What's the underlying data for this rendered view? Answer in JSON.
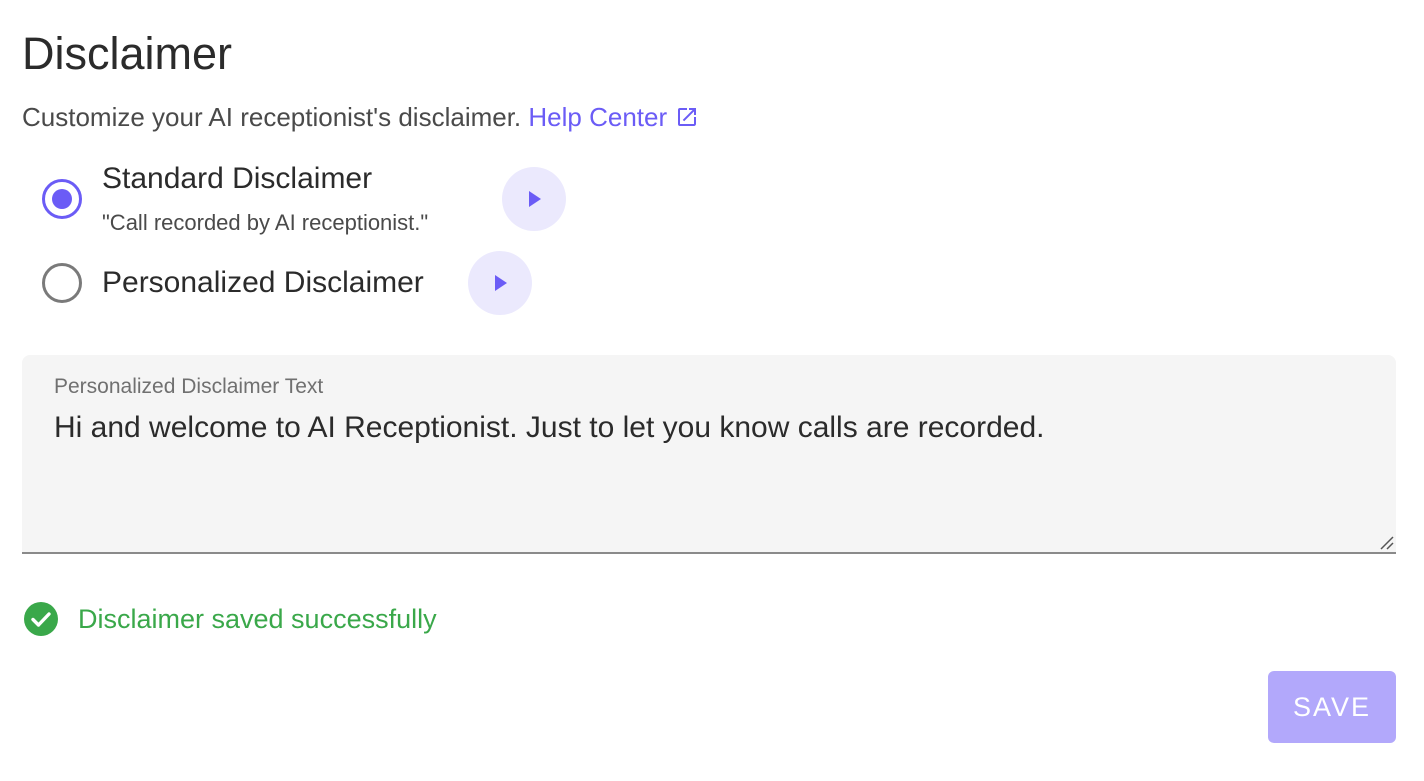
{
  "title": "Disclaimer",
  "subtitle": {
    "text": "Customize your AI receptionist's disclaimer.",
    "link_label": "Help Center",
    "link_icon": "external-link-icon"
  },
  "options": [
    {
      "label": "Standard Disclaimer",
      "description": "\"Call recorded by AI receptionist.\"",
      "selected": true,
      "play_icon": "play-icon"
    },
    {
      "label": "Personalized Disclaimer",
      "selected": false,
      "play_icon": "play-icon"
    }
  ],
  "text_field": {
    "label": "Personalized Disclaimer Text",
    "value": "Hi and welcome to AI Receptionist. Just to let you know calls are recorded."
  },
  "status": {
    "icon": "check-circle-icon",
    "message": "Disclaimer saved successfully"
  },
  "save_label": "SAVE",
  "colors": {
    "accent": "#6b5cf6",
    "accent_light": "#ebe9fd",
    "success": "#3aa84a",
    "save_disabled": "#b2a8fb"
  }
}
